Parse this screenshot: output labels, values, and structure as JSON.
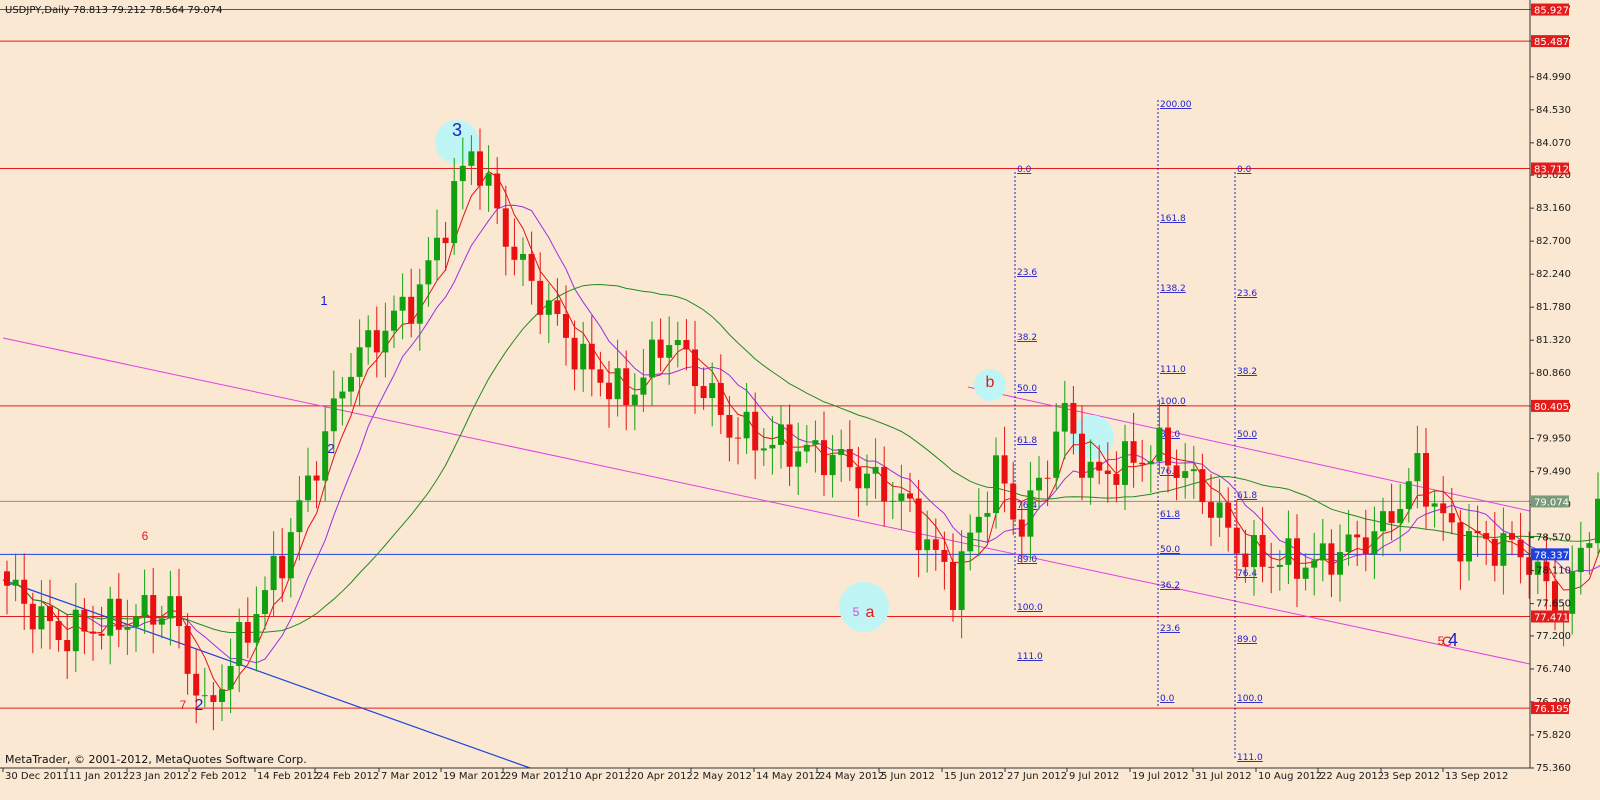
{
  "header": {
    "symbol": "USDJPY,Daily",
    "ohlc": "78.813 79.212 78.564 79.074"
  },
  "footer": {
    "copyright": "MetaTrader, © 2001-2012, MetaQuotes Software Corp."
  },
  "colors": {
    "background": "#FBE8D3",
    "bull_candle": "#10A010",
    "bear_candle": "#E81010",
    "horizontal_level": "#E21B1B",
    "channel": "#E040E0",
    "trendline": "#1E40E0",
    "fast_ma": "#E81010",
    "mid_ma": "#9B30E0",
    "slow_ma": "#208A20",
    "fib": "#1E1EC8",
    "highlight": "#BFF5F5"
  },
  "chart_data": {
    "type": "candlestick",
    "symbol": "USDJPY",
    "timeframe": "Daily",
    "ylim": [
      75.36,
      86.06
    ],
    "price_ticks": [
      "85.927",
      "85.487",
      "84.990",
      "84.530",
      "84.070",
      "83.620",
      "83.160",
      "82.700",
      "82.240",
      "81.780",
      "81.320",
      "80.860",
      "80.400",
      "79.950",
      "79.490",
      "79.030",
      "78.570",
      "78.110",
      "77.650",
      "77.200",
      "76.740",
      "76.280",
      "75.820",
      "75.360"
    ],
    "date_labels": [
      "30 Dec 2011",
      "11 Jan 2012",
      "23 Jan 2012",
      "2 Feb 2012",
      "14 Feb 2012",
      "24 Feb 2012",
      "7 Mar 2012",
      "19 Mar 2012",
      "29 Mar 2012",
      "10 Apr 2012",
      "20 Apr 2012",
      "2 May 2012",
      "14 May 2012",
      "24 May 2012",
      "5 Jun 2012",
      "15 Jun 2012",
      "27 Jun 2012",
      "9 Jul 2012",
      "19 Jul 2012",
      "31 Jul 2012",
      "10 Aug 2012",
      "22 Aug 2012",
      "3 Sep 2012",
      "13 Sep 2012"
    ],
    "horizontal_levels": [
      {
        "price": 85.927,
        "label": "85.927",
        "color": "#E21B1B"
      },
      {
        "price": 85.487,
        "label": "85.487",
        "color": "#E21B1B"
      },
      {
        "price": 83.712,
        "label": "83.712",
        "color": "#E21B1B"
      },
      {
        "price": 80.405,
        "label": "80.405",
        "color": "#E21B1B"
      },
      {
        "price": 79.074,
        "label": "79.074",
        "color": "#7A9A7A"
      },
      {
        "price": 78.337,
        "label": "78.337",
        "color": "#1E40E0"
      },
      {
        "price": 77.471,
        "label": "77.471",
        "color": "#E21B1B"
      },
      {
        "price": 76.195,
        "label": "76.195",
        "color": "#E21B1B"
      }
    ],
    "key_points": [
      {
        "date": "30 Dec 2011",
        "price": 77.9
      },
      {
        "date": "9 Jan 2012",
        "price": 77.2
      },
      {
        "date": "26 Jan 2012",
        "price": 77.6
      },
      {
        "date": "1 Feb 2012",
        "price": 76.1
      },
      {
        "date": "14 Feb 2012",
        "price": 78.3
      },
      {
        "date": "24 Feb 2012",
        "price": 81.0
      },
      {
        "date": "7 Mar 2012",
        "price": 82.0
      },
      {
        "date": "15 Mar 2012",
        "price": 84.0
      },
      {
        "date": "22 Mar 2012",
        "price": 82.5
      },
      {
        "date": "3 Apr 2012",
        "price": 81.0
      },
      {
        "date": "10 Apr 2012",
        "price": 80.5
      },
      {
        "date": "17 Apr 2012",
        "price": 81.4
      },
      {
        "date": "26 Apr 2012",
        "price": 80.1
      },
      {
        "date": "2 May 2012",
        "price": 79.9
      },
      {
        "date": "14 May 2012",
        "price": 79.7
      },
      {
        "date": "24 May 2012",
        "price": 79.1
      },
      {
        "date": "1 Jun 2012",
        "price": 77.9
      },
      {
        "date": "8 Jun 2012",
        "price": 79.5
      },
      {
        "date": "13 Jun 2012",
        "price": 78.7
      },
      {
        "date": "20 Jun 2012",
        "price": 80.3
      },
      {
        "date": "25 Jun 2012",
        "price": 79.4
      },
      {
        "date": "5 Jul 2012",
        "price": 79.8
      },
      {
        "date": "12 Jul 2012",
        "price": 79.2
      },
      {
        "date": "19 Jul 2012",
        "price": 78.3
      },
      {
        "date": "31 Jul 2012",
        "price": 78.2
      },
      {
        "date": "10 Aug 2012",
        "price": 78.7
      },
      {
        "date": "16 Aug 2012",
        "price": 79.5
      },
      {
        "date": "22 Aug 2012",
        "price": 78.6
      },
      {
        "date": "3 Sep 2012",
        "price": 78.4
      },
      {
        "date": "10 Sep 2012",
        "price": 77.5
      },
      {
        "date": "13 Sep 2012",
        "price": 78.8
      },
      {
        "date": "17 Sep 2012",
        "price": 79.07
      }
    ],
    "wave_labels": [
      {
        "text": "3",
        "color": "#1E1EC8",
        "circled": true
      },
      {
        "text": "b",
        "color": "#E21B1B",
        "circled": true
      },
      {
        "text": "a",
        "color": "#E21B1B",
        "circled": true
      },
      {
        "text": "5",
        "color": "#E040E0"
      },
      {
        "text": "5",
        "color": "#E21B1B"
      },
      {
        "text": "C",
        "color": "#E21B1B"
      },
      {
        "text": "4",
        "color": "#1E1EC8"
      },
      {
        "text": "7",
        "color": "#E21B1B"
      },
      {
        "text": "2",
        "color": "#1E1EC8"
      },
      {
        "text": "6",
        "color": "#E21B1B"
      },
      {
        "text": "1",
        "color": "#1E1EC8"
      },
      {
        "text": "2",
        "color": "#1E1EC8"
      }
    ],
    "fib_levels_1": [
      "0.0",
      "23.6",
      "38.2",
      "50.0",
      "61.8",
      "76.4",
      "89.0",
      "100.0",
      "111.0"
    ],
    "fib_levels_2": [
      "200.00",
      "161.8",
      "138.2",
      "111.0",
      "100.0",
      "89.0",
      "76.4",
      "61.8",
      "50.0",
      "36.2",
      "23.6",
      "0.0"
    ],
    "fib_levels_3": [
      "0.0",
      "23.6",
      "38.2",
      "50.0",
      "61.8",
      "76.4",
      "89.0",
      "100.0",
      "111.0"
    ]
  }
}
